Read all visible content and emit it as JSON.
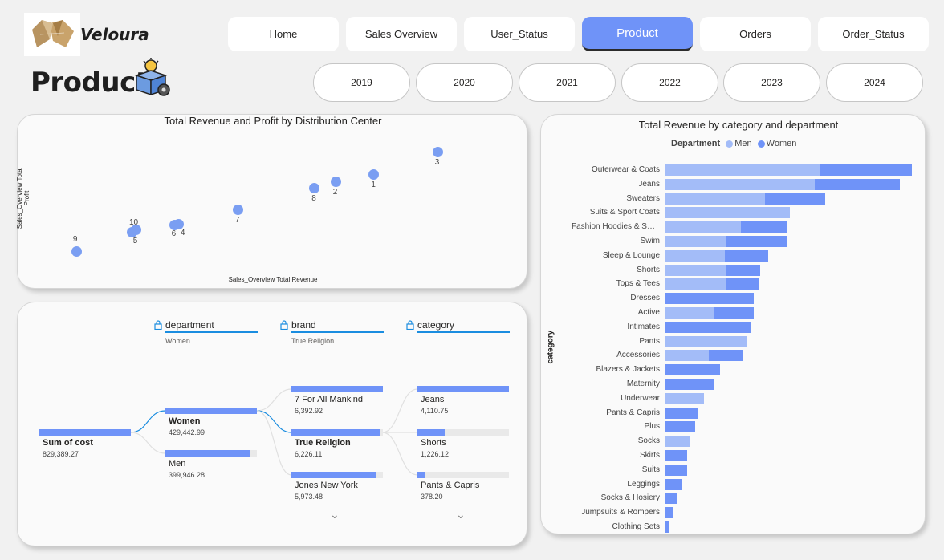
{
  "brand": {
    "name": "Veloura"
  },
  "page": {
    "title": "Product"
  },
  "nav": [
    {
      "label": "Home",
      "active": false
    },
    {
      "label": "Sales Overview",
      "active": false
    },
    {
      "label": "User_Status",
      "active": false
    },
    {
      "label": "Product",
      "active": true
    },
    {
      "label": "Orders",
      "active": false
    },
    {
      "label": "Order_Status",
      "active": false
    }
  ],
  "years": [
    "2019",
    "2020",
    "2021",
    "2022",
    "2023",
    "2024"
  ],
  "scatter": {
    "title": "Total Revenue and Profit by Distribution Center",
    "xlabel": "Sales_Overview Total Revenue",
    "ylabel": "Sales_Overview Total Profit"
  },
  "decomposition": {
    "columns": [
      {
        "label": "department",
        "selected": "Women"
      },
      {
        "label": "brand",
        "selected": "True Religion"
      },
      {
        "label": "category",
        "selected": ""
      }
    ],
    "root": {
      "label": "Sum of cost",
      "value": "829,389.27",
      "fraction": 1.0
    },
    "department": [
      {
        "label": "Women",
        "value": "429,442.99",
        "fraction": 1.0,
        "bold": true
      },
      {
        "label": "Men",
        "value": "399,946.28",
        "fraction": 0.93,
        "bold": false
      }
    ],
    "brand": [
      {
        "label": "7 For All Mankind",
        "value": "6,392.92",
        "fraction": 1.0,
        "bold": false
      },
      {
        "label": "True Religion",
        "value": "6,226.11",
        "fraction": 0.97,
        "bold": true
      },
      {
        "label": "Jones New York",
        "value": "5,973.48",
        "fraction": 0.93,
        "bold": false
      }
    ],
    "category": [
      {
        "label": "Jeans",
        "value": "4,110.75",
        "fraction": 1.0
      },
      {
        "label": "Shorts",
        "value": "1,226.12",
        "fraction": 0.3
      },
      {
        "label": "Pants & Capris",
        "value": "378.20",
        "fraction": 0.09
      }
    ]
  },
  "chart_data": [
    {
      "type": "scatter",
      "title": "Total Revenue and Profit by Distribution Center",
      "xlabel": "Sales_Overview Total Revenue",
      "ylabel": "Sales_Overview Total Profit",
      "grid": false,
      "points": [
        {
          "label": "1",
          "x": 0.8,
          "y": 0.74
        },
        {
          "label": "2",
          "x": 0.71,
          "y": 0.68
        },
        {
          "label": "3",
          "x": 0.95,
          "y": 0.93
        },
        {
          "label": "4",
          "x": 0.34,
          "y": 0.33
        },
        {
          "label": "5",
          "x": 0.23,
          "y": 0.26
        },
        {
          "label": "6",
          "x": 0.33,
          "y": 0.32
        },
        {
          "label": "7",
          "x": 0.48,
          "y": 0.45
        },
        {
          "label": "8",
          "x": 0.66,
          "y": 0.63
        },
        {
          "label": "9",
          "x": 0.1,
          "y": 0.1
        },
        {
          "label": "10",
          "x": 0.24,
          "y": 0.28
        }
      ]
    },
    {
      "type": "bar",
      "orientation": "horizontal",
      "stacked": true,
      "title": "Total Revenue by category and department",
      "ylabel": "category",
      "legend": {
        "title": "Department",
        "position": "top-left"
      },
      "categories": [
        "Outerwear & Coats",
        "Jeans",
        "Sweaters",
        "Suits & Sport Coats",
        "Fashion Hoodies & Sweatshirts",
        "Swim",
        "Sleep & Lounge",
        "Shorts",
        "Tops & Tees",
        "Dresses",
        "Active",
        "Intimates",
        "Pants",
        "Accessories",
        "Blazers & Jackets",
        "Maternity",
        "Underwear",
        "Pants & Capris",
        "Plus",
        "Socks",
        "Skirts",
        "Suits",
        "Leggings",
        "Socks & Hosiery",
        "Jumpsuits & Rompers",
        "Clothing Sets"
      ],
      "series": [
        {
          "name": "Men",
          "color": "#a3bcf8",
          "values": [
            193,
            186,
            124,
            155,
            94,
            75,
            74,
            75,
            75,
            0,
            60,
            0,
            101,
            54,
            0,
            0,
            48,
            0,
            0,
            30,
            0,
            0,
            0,
            0,
            0,
            0
          ]
        },
        {
          "name": "Women",
          "color": "#6f93f8",
          "values": [
            114,
            106,
            75,
            0,
            57,
            76,
            54,
            43,
            41,
            110,
            50,
            107,
            0,
            43,
            68,
            61,
            0,
            41,
            37,
            0,
            27,
            27,
            21,
            15,
            9,
            4
          ]
        }
      ]
    }
  ]
}
